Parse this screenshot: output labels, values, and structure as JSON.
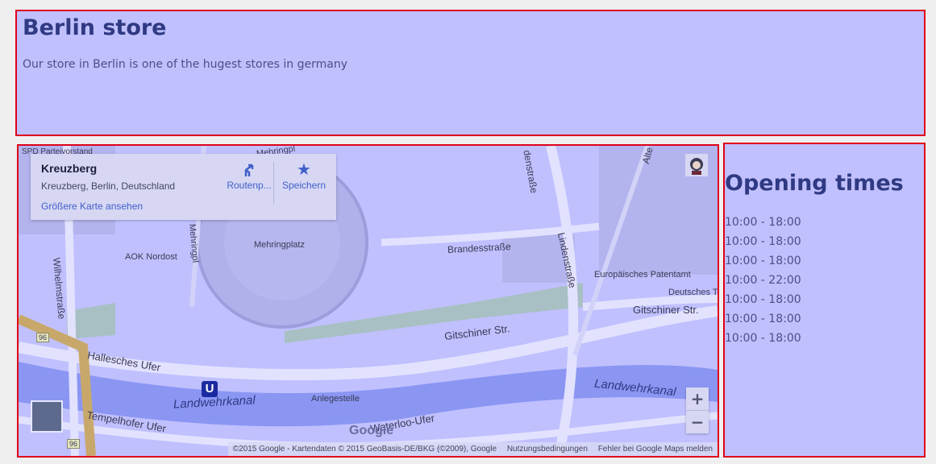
{
  "store": {
    "title": "Berlin store",
    "description": "Our store in Berlin is one of the hugest stores in germany"
  },
  "map": {
    "place_name": "Kreuzberg",
    "address": "Kreuzberg, Berlin, Deutschland",
    "bigger_map_link": "Größere Karte ansehen",
    "route_label": "Routenp...",
    "save_label": "Speichern",
    "zoom_in": "+",
    "zoom_out": "−",
    "google_logo": "Google",
    "attribution": "©2015 Google - Kartendaten © 2015 GeoBasis-DE/BKG (©2009), Google",
    "terms": "Nutzungsbedingungen",
    "report": "Fehler bei Google Maps melden",
    "labels": {
      "spd": "SPD Parteivorstand",
      "mehringpl_top": "Mehringpl",
      "denstrasse": "denstraße",
      "alte": "Alte",
      "mehringplatz": "Mehringplatz",
      "mehringpl_left": "Mehringpl",
      "brandesstrasse": "Brandesstraße",
      "lindenstrasse": "Lindenstraße",
      "aok": "AOK Nordost",
      "wilhelmstrasse": "Wilhelmstraße",
      "patentamt": "Europäisches Patentamt",
      "deutsches": "Deutsches Te",
      "gitschiner1": "Gitschiner Str.",
      "gitschiner2": "Gitschiner Str.",
      "hallesches": "Hallesches Ufer",
      "landwehr1": "Landwehrkanal",
      "landwehr2": "Landwehrkanal",
      "anlegestelle": "Anlegestelle",
      "tempelhofer": "Tempelhofer Ufer",
      "waterloo": "Waterloo-Ufer",
      "route96a": "96",
      "route96b": "96",
      "ubahn": "U"
    }
  },
  "hours": {
    "title": "Opening times",
    "times": [
      "10:00 - 18:00",
      "10:00 - 18:00",
      "10:00 - 18:00",
      "10:00 - 22:00",
      "10:00 - 18:00",
      "10:00 - 18:00",
      "10:00 - 18:00"
    ]
  },
  "colors": {
    "border": "#e0001b",
    "panel": "#c0c0ff",
    "title": "#2f3a82",
    "link": "#4060c8"
  }
}
